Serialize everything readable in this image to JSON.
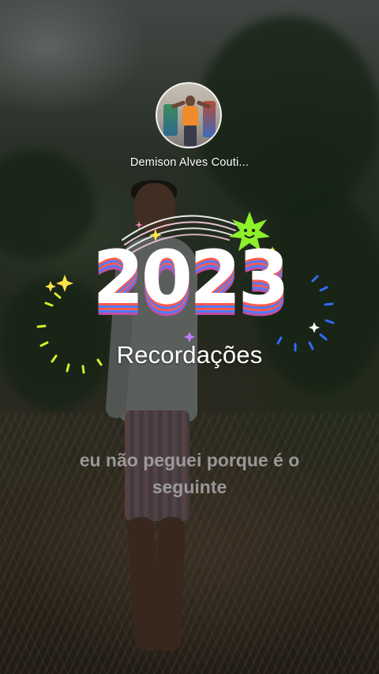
{
  "profile": {
    "name": "Demison Alves Couti..."
  },
  "badge": {
    "year": "2023",
    "subtitle": "Recordações"
  },
  "caption": {
    "text": "eu não peguei porque é o seguinte"
  },
  "colors": {
    "year_stripe_red": "#ff5a4d",
    "year_stripe_blue": "#4f7bff",
    "sun_green": "#8df02a",
    "sparkle_yellow": "#ffe14a",
    "sparkle_blue": "#2f6bff"
  },
  "icons": {
    "sun": "smiling-sun-icon",
    "sparkle": "sparkle-icon",
    "rainbow": "rainbow-arc-icon"
  }
}
